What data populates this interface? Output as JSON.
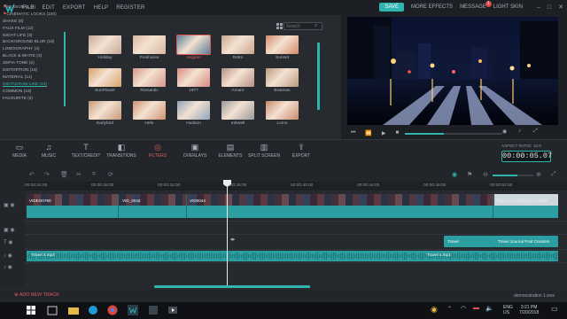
{
  "menu": [
    "FILE",
    "EDIT",
    "EXPORT",
    "HELP",
    "REGISTER"
  ],
  "topright": {
    "save": "SAVE",
    "more_effects": "MORE EFFECTS",
    "message": "MESSAGE",
    "message_badge": "1",
    "light_skin": "LIGHT SKIN"
  },
  "categories": [
    {
      "label": "SEASONAL (4)",
      "pinned": true
    },
    {
      "label": "CINEMATIC LOOKS (100)",
      "pinned": true
    },
    {
      "label": "SHAKE (8)"
    },
    {
      "label": "FAUX FILM (12)"
    },
    {
      "label": "NIGHT LIFE (3)"
    },
    {
      "label": "BACKGROUND BLUR (16)"
    },
    {
      "label": "LOMOGRAPHY (4)"
    },
    {
      "label": "BLACK & WHITE (3)"
    },
    {
      "label": "SEPIA TONE (2)"
    },
    {
      "label": "DISTORTION (18)"
    },
    {
      "label": "MATERIAL (11)"
    },
    {
      "label": "INSTAGRAM-LIKE (24)",
      "active": true
    },
    {
      "label": "COMMON (16)"
    },
    {
      "label": "FAVOURITE (0)"
    }
  ],
  "search": {
    "placeholder": "Search"
  },
  "filters": [
    {
      "label": "Holiday",
      "color": "#c7a89a"
    },
    {
      "label": "Freshview",
      "color": "#d9b8a0"
    },
    {
      "label": "Aegean",
      "color": "#5a7c96",
      "highlight": true
    },
    {
      "label": "Retro",
      "color": "#c9a68f"
    },
    {
      "label": "Sunset",
      "color": "#d48b6a"
    },
    {
      "label": "SunFlower",
      "color": "#d6a26b"
    },
    {
      "label": "Romantic",
      "color": "#d6968a"
    },
    {
      "label": "1977",
      "color": "#d88a80"
    },
    {
      "label": "Amaro",
      "color": "#b78f88"
    },
    {
      "label": "Brannan",
      "color": "#b99a7c"
    },
    {
      "label": "Earlybird",
      "color": "#c79a78"
    },
    {
      "label": "Hefe",
      "color": "#cf9372"
    },
    {
      "label": "Hudson",
      "color": "#8fa4ba"
    },
    {
      "label": "InkWell",
      "color": "#9a9a9a"
    },
    {
      "label": "Lomo",
      "color": "#c88a6e"
    }
  ],
  "tools": [
    {
      "label": "MEDIA"
    },
    {
      "label": "MUSIC"
    },
    {
      "label": "TEXT/CREDIT"
    },
    {
      "label": "TRANSITIONS"
    },
    {
      "label": "FILTERS",
      "active": true
    },
    {
      "label": "OVERLAYS"
    },
    {
      "label": "ELEMENTS"
    },
    {
      "label": "SPLIT SCREEN"
    },
    {
      "label": "EXPORT"
    }
  ],
  "aspect_ratio": "ASPECT RATIO: 16:9",
  "timecode": "00:00:05.07",
  "ruler": [
    "00:00:24:00",
    "00:00:28:00",
    "00:00:32:00",
    "00:00:36:00",
    "00:00:40:00",
    "00:00:44:00",
    "00:00:48:00",
    "00:00:52:00"
  ],
  "clips": {
    "video": [
      "VIDEO0790",
      "VID_0043",
      "VID0044"
    ],
    "video_end": "Travel Journal Post Creators",
    "audio": "Travel 4.mp3",
    "audio2": "Travel 4.mp3",
    "text1": "Travel",
    "text2": "Travel Journal Post Creators"
  },
  "add_track": "ADD NEW TRACK",
  "project_name": "demonstration 1.wve",
  "tray": {
    "lang": "ENG",
    "region": "US",
    "time": "3:21 PM",
    "date": "7/20/2018"
  },
  "colors": {
    "accent": "#2fb4b0",
    "active": "#e05a5a",
    "clip": "#2a9ea0"
  }
}
